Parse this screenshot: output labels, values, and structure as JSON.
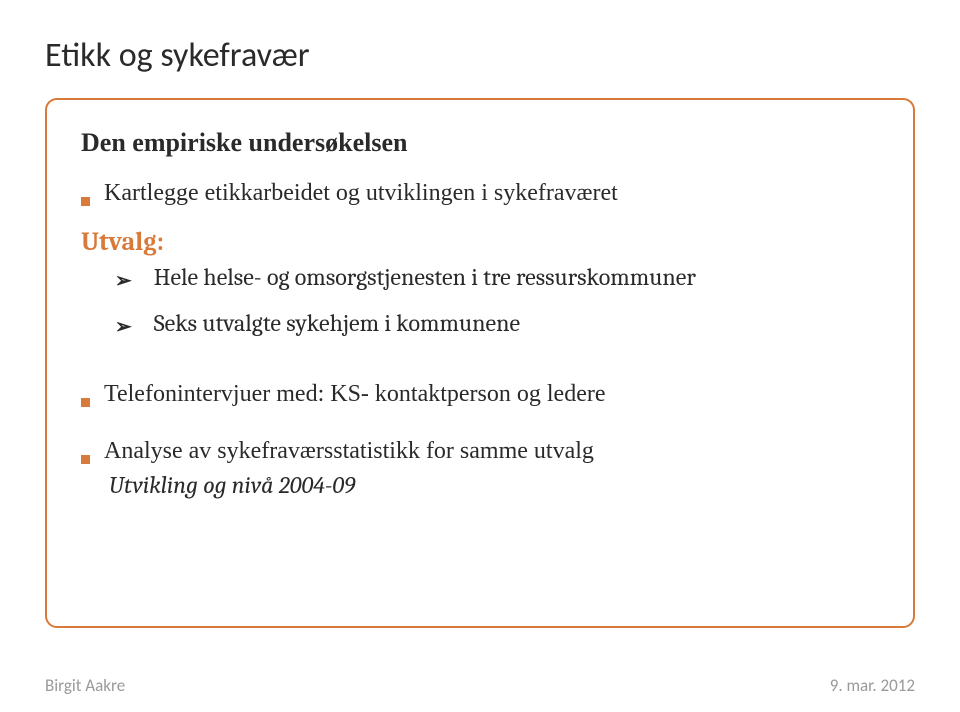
{
  "title": "Etikk og sykefravær",
  "heading": "Den empiriske undersøkelsen",
  "bullet1": "Kartlegge etikkarbeidet og utviklingen i sykefraværet",
  "subheading": "Utvalg:",
  "arrow1": "Hele helse- og omsorgstjenesten i tre ressurskommuner",
  "arrow2": "Seks utvalgte sykehjem i kommunene",
  "bullet2": "Telefonintervjuer  med: KS- kontaktperson og ledere",
  "bullet3": "Analyse av sykefraværsstatistikk for samme utvalg",
  "note": "Utvikling og nivå 2004-09",
  "footer_left": "Birgit Aakre",
  "footer_right": "9. mar. 2012"
}
